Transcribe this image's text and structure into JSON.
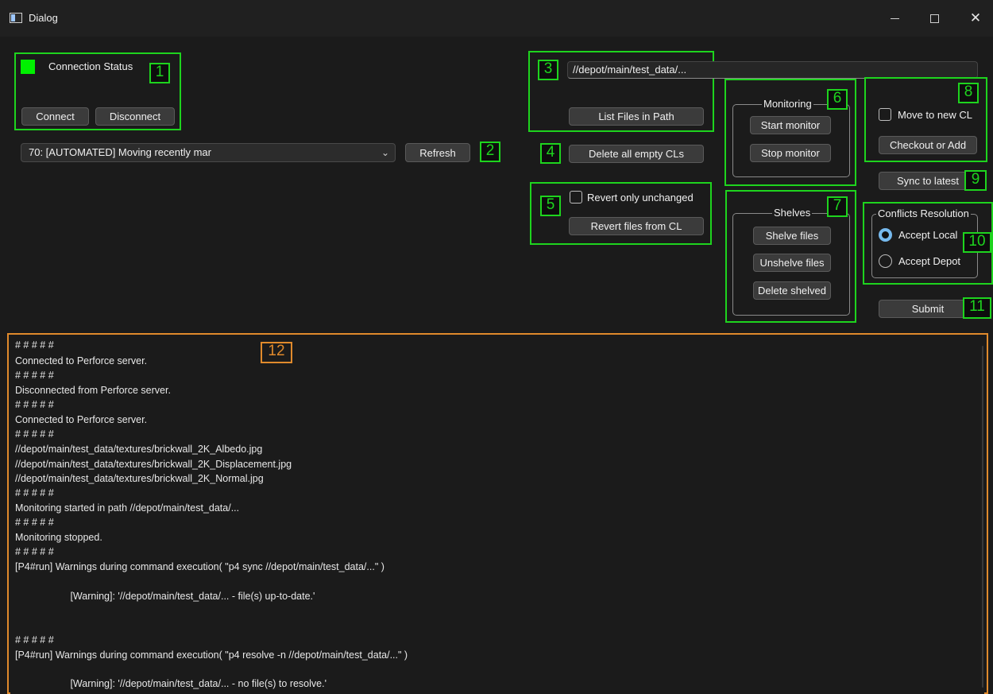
{
  "window": {
    "title": "Dialog",
    "icon": "app-window-icon"
  },
  "colors": {
    "annotation_green": "#1ed41e",
    "annotation_orange": "#e08a2c",
    "status_led": "#00f000",
    "radio_accent": "#76b9ed"
  },
  "annotations": [
    "1",
    "2",
    "3",
    "4",
    "5",
    "6",
    "7",
    "8",
    "9",
    "10",
    "11",
    "12"
  ],
  "connection": {
    "status_label": "Connection Status",
    "connect": "Connect",
    "disconnect": "Disconnect"
  },
  "changelist": {
    "selected": "70: [AUTOMATED] Moving recently mar",
    "refresh": "Refresh"
  },
  "path": {
    "value": "//depot/main/test_data/...",
    "list_files": "List Files in Path"
  },
  "delete_empty": "Delete all empty CLs",
  "revert": {
    "only_unchanged": "Revert only unchanged",
    "revert_files": "Revert files from CL"
  },
  "monitoring": {
    "title": "Monitoring",
    "start": "Start monitor",
    "stop": "Stop monitor"
  },
  "shelves": {
    "title": "Shelves",
    "shelve": "Shelve files",
    "unshelve": "Unshelve files",
    "delete": "Delete shelved"
  },
  "checkout": {
    "move_new_cl": "Move to new CL",
    "checkout_add": "Checkout or Add"
  },
  "sync": "Sync to latest",
  "conflicts": {
    "title": "Conflicts Resolution",
    "accept_local": "Accept Local",
    "accept_depot": "Accept Depot",
    "selected": "Accept Local"
  },
  "submit": "Submit",
  "log": [
    "# # # # #",
    "Connected to Perforce server.",
    "# # # # #",
    "Disconnected from Perforce server.",
    "# # # # #",
    "Connected to Perforce server.",
    "# # # # #",
    "//depot/main/test_data/textures/brickwall_2K_Albedo.jpg",
    "//depot/main/test_data/textures/brickwall_2K_Displacement.jpg",
    "//depot/main/test_data/textures/brickwall_2K_Normal.jpg",
    "# # # # #",
    "Monitoring started in path //depot/main/test_data/...",
    "# # # # #",
    "Monitoring stopped.",
    "# # # # #",
    "[P4#run] Warnings during command execution( \"p4 sync //depot/main/test_data/...\" )",
    "",
    "                    [Warning]: '//depot/main/test_data/... - file(s) up-to-date.'",
    "",
    "",
    "# # # # #",
    "[P4#run] Warnings during command execution( \"p4 resolve -n //depot/main/test_data/...\" )",
    "",
    "                    [Warning]: '//depot/main/test_data/... - no file(s) to resolve.'"
  ]
}
